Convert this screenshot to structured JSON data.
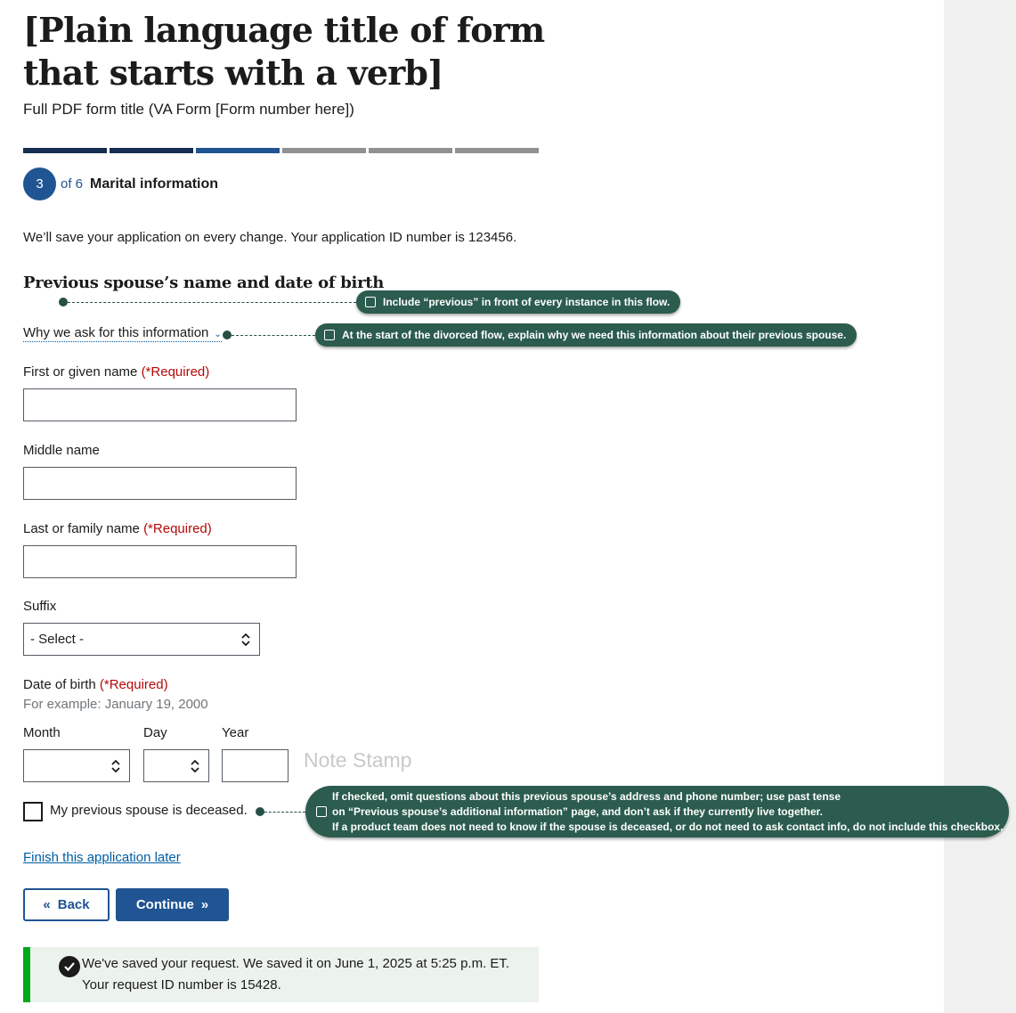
{
  "form": {
    "title": "[Plain language title of form that starts with a verb]",
    "subtitle": "Full PDF form title (VA Form [Form number here])"
  },
  "progress": {
    "total_steps": 6,
    "current_step": 3,
    "step_number": "3",
    "of_text": "of 6",
    "step_name": "Marital information"
  },
  "save_message": "We’ll save your application on every change. Your application ID number is 123456.",
  "section": {
    "heading": "Previous spouse’s name and date of birth",
    "why_link": "Why we ask for this information"
  },
  "fields": {
    "first_name_label": "First or given name",
    "middle_name_label": "Middle name",
    "last_name_label": "Last or family name",
    "required": "(*Required)",
    "suffix_label": "Suffix",
    "suffix_value": "- Select -",
    "dob_label": "Date of birth",
    "dob_hint": "For example: January 19, 2000",
    "month_label": "Month",
    "day_label": "Day",
    "year_label": "Year"
  },
  "note_stamp": "Note Stamp",
  "checkbox": {
    "label": "My previous spouse is deceased.",
    "checked": false
  },
  "finish_link": "Finish this application later",
  "buttons": {
    "back": "Back",
    "continue": "Continue"
  },
  "alert": {
    "line1": "We've saved your request. We saved it on June 1, 2025 at 5:25 p.m. ET.",
    "line2": "Your request ID number is 15428."
  },
  "annotations": {
    "heading_note": "Include “previous” in front of every instance in this flow.",
    "why_note": "At the start of the divorced flow, explain why we need this information about their previous spouse.",
    "checkbox_note": [
      "If checked, omit questions about this previous spouse’s address and phone number; use past tense",
      "on “Previous spouse’s additional information” page, and don’t ask if they currently live together.",
      "If a product team does not need to know if the spouse is deceased, or do not need to ask contact info, do not include this checkbox."
    ]
  },
  "colors": {
    "primary": "#205493",
    "progress_done": "#162e51",
    "progress_pending": "#919191",
    "required": "#b50909",
    "link": "#005ea2",
    "success_border": "#00a91c",
    "success_bg": "#ecf3ec",
    "annotation": "#2b5c4e"
  }
}
